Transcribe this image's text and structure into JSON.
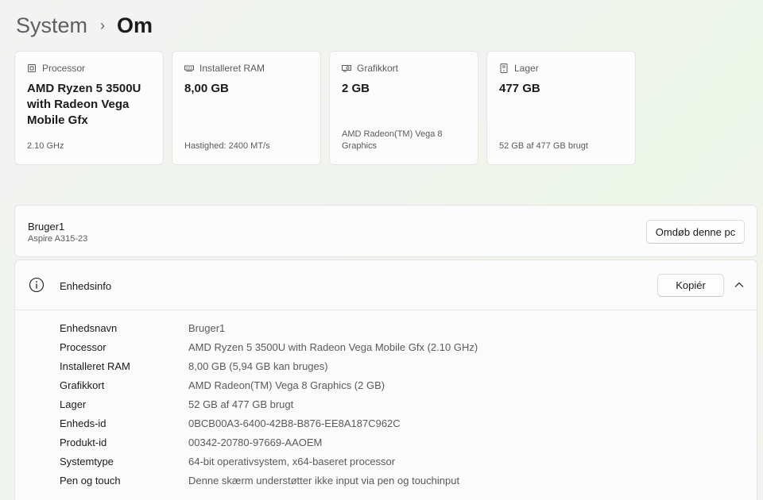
{
  "breadcrumb": {
    "parent": "System",
    "current": "Om"
  },
  "cards": [
    {
      "label": "Processor",
      "icon": "processor-icon",
      "value": "AMD Ryzen 5 3500U with Radeon Vega Mobile Gfx",
      "sub": "2.10 GHz"
    },
    {
      "label": "Installeret RAM",
      "icon": "ram-icon",
      "value": "8,00 GB",
      "sub": "Hastighed: 2400 MT/s"
    },
    {
      "label": "Grafikkort",
      "icon": "graphics-card-icon",
      "value": "2 GB",
      "sub": "AMD Radeon(TM) Vega 8 Graphics"
    },
    {
      "label": "Lager",
      "icon": "storage-icon",
      "value": "477 GB",
      "sub": "52 GB af 477 GB brugt"
    }
  ],
  "pc": {
    "name": "Bruger1",
    "model": "Aspire A315-23",
    "rename_label": "Omdøb denne pc"
  },
  "device_info": {
    "title": "Enhedsinfo",
    "copy_label": "Kopiér",
    "rows": [
      {
        "label": "Enhedsnavn",
        "value": "Bruger1"
      },
      {
        "label": "Processor",
        "value": "AMD Ryzen 5 3500U with Radeon Vega Mobile Gfx (2.10 GHz)"
      },
      {
        "label": "Installeret RAM",
        "value": "8,00 GB (5,94 GB kan bruges)"
      },
      {
        "label": "Grafikkort",
        "value": "AMD Radeon(TM) Vega 8 Graphics (2 GB)"
      },
      {
        "label": "Lager",
        "value": "52 GB af 477 GB brugt"
      },
      {
        "label": "Enheds-id",
        "value": "0BCB00A3-6400-42B8-B876-EE8A187C962C"
      },
      {
        "label": "Produkt-id",
        "value": "00342-20780-97669-AAOEM"
      },
      {
        "label": "Systemtype",
        "value": "64-bit operativsystem, x64-baseret processor"
      },
      {
        "label": "Pen og touch",
        "value": "Denne skærm understøtter ikke input via pen og touchinput"
      }
    ]
  },
  "colors": {
    "background": "#f3f3f3",
    "card": "#fcfcfc",
    "border": "#e5e5e5",
    "secondary_text": "#5a5a5a"
  }
}
